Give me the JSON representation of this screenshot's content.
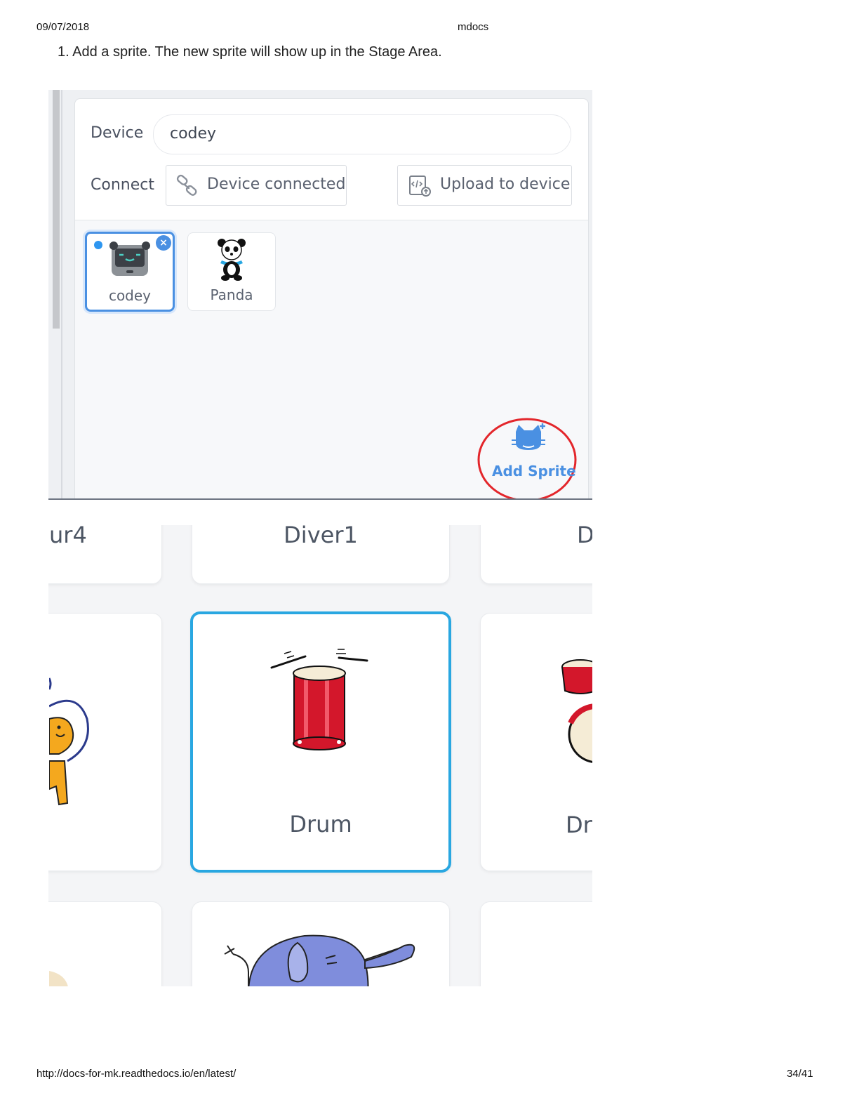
{
  "header": {
    "date": "09/07/2018",
    "title": "mdocs"
  },
  "step_text": "1. Add a sprite. The new sprite will show up in the Stage Area.",
  "device_panel": {
    "device_label": "Device",
    "device_value": "codey",
    "connect_label": "Connect",
    "connected_button": "Device connected",
    "upload_button": "Upload to device"
  },
  "sprites": [
    {
      "name": "codey",
      "selected": true
    },
    {
      "name": "Panda",
      "selected": false
    }
  ],
  "add_sprite": {
    "label": "Add Sprite",
    "highlight_color": "#e3262b"
  },
  "library": {
    "row1": [
      "ur4",
      "Diver1",
      "D"
    ],
    "row2": [
      "Drum",
      "Dr"
    ],
    "selected_color": "#29a7e1"
  },
  "footer": {
    "url": "http://docs-for-mk.readthedocs.io/en/latest/",
    "page": "34/41"
  }
}
